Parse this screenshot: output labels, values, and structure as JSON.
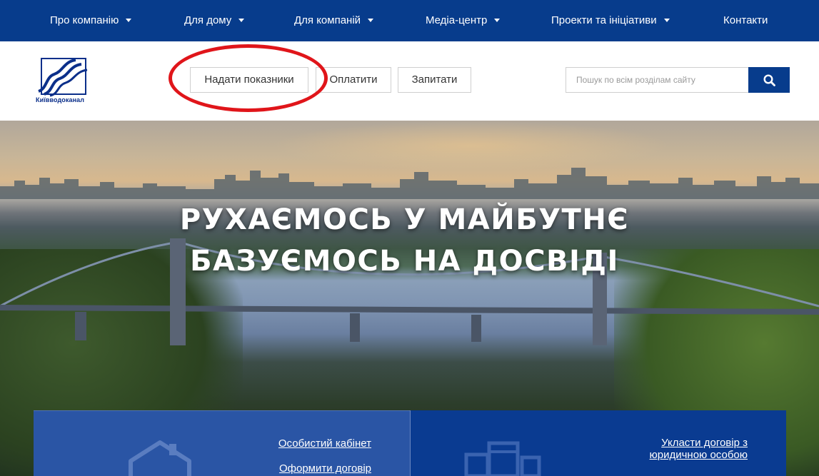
{
  "topnav": {
    "items": [
      {
        "label": "Про компанію",
        "dropdown": true
      },
      {
        "label": "Для дому",
        "dropdown": true
      },
      {
        "label": "Для компаній",
        "dropdown": true
      },
      {
        "label": "Медіа-центр",
        "dropdown": true
      },
      {
        "label": "Проекти та ініціативи",
        "dropdown": true
      },
      {
        "label": "Контакти",
        "dropdown": false
      }
    ]
  },
  "header": {
    "logo_text": "Київводоканал",
    "buttons": {
      "submit_readings": "Надати показники",
      "pay": "Оплатити",
      "ask": "Запитати"
    },
    "search": {
      "placeholder": "Пошук по всім розділам сайту",
      "icon": "search-icon"
    }
  },
  "hero": {
    "line1": "РУХАЄМОСЬ У МАЙБУТНЄ",
    "line2": "БАЗУЄМОСЬ НА ДОСВІДІ"
  },
  "cards": {
    "home": {
      "icon": "house-icon",
      "links": [
        "Особистий кабінет",
        "Оформити договір"
      ]
    },
    "business": {
      "icon": "factory-icon",
      "links": [
        "Укласти договір з юридичною особою"
      ]
    }
  },
  "colors": {
    "brand_blue": "#073c8c",
    "highlight_red": "#e0151a",
    "card_left": "#2a55a5",
    "card_right": "#0a3b91"
  }
}
